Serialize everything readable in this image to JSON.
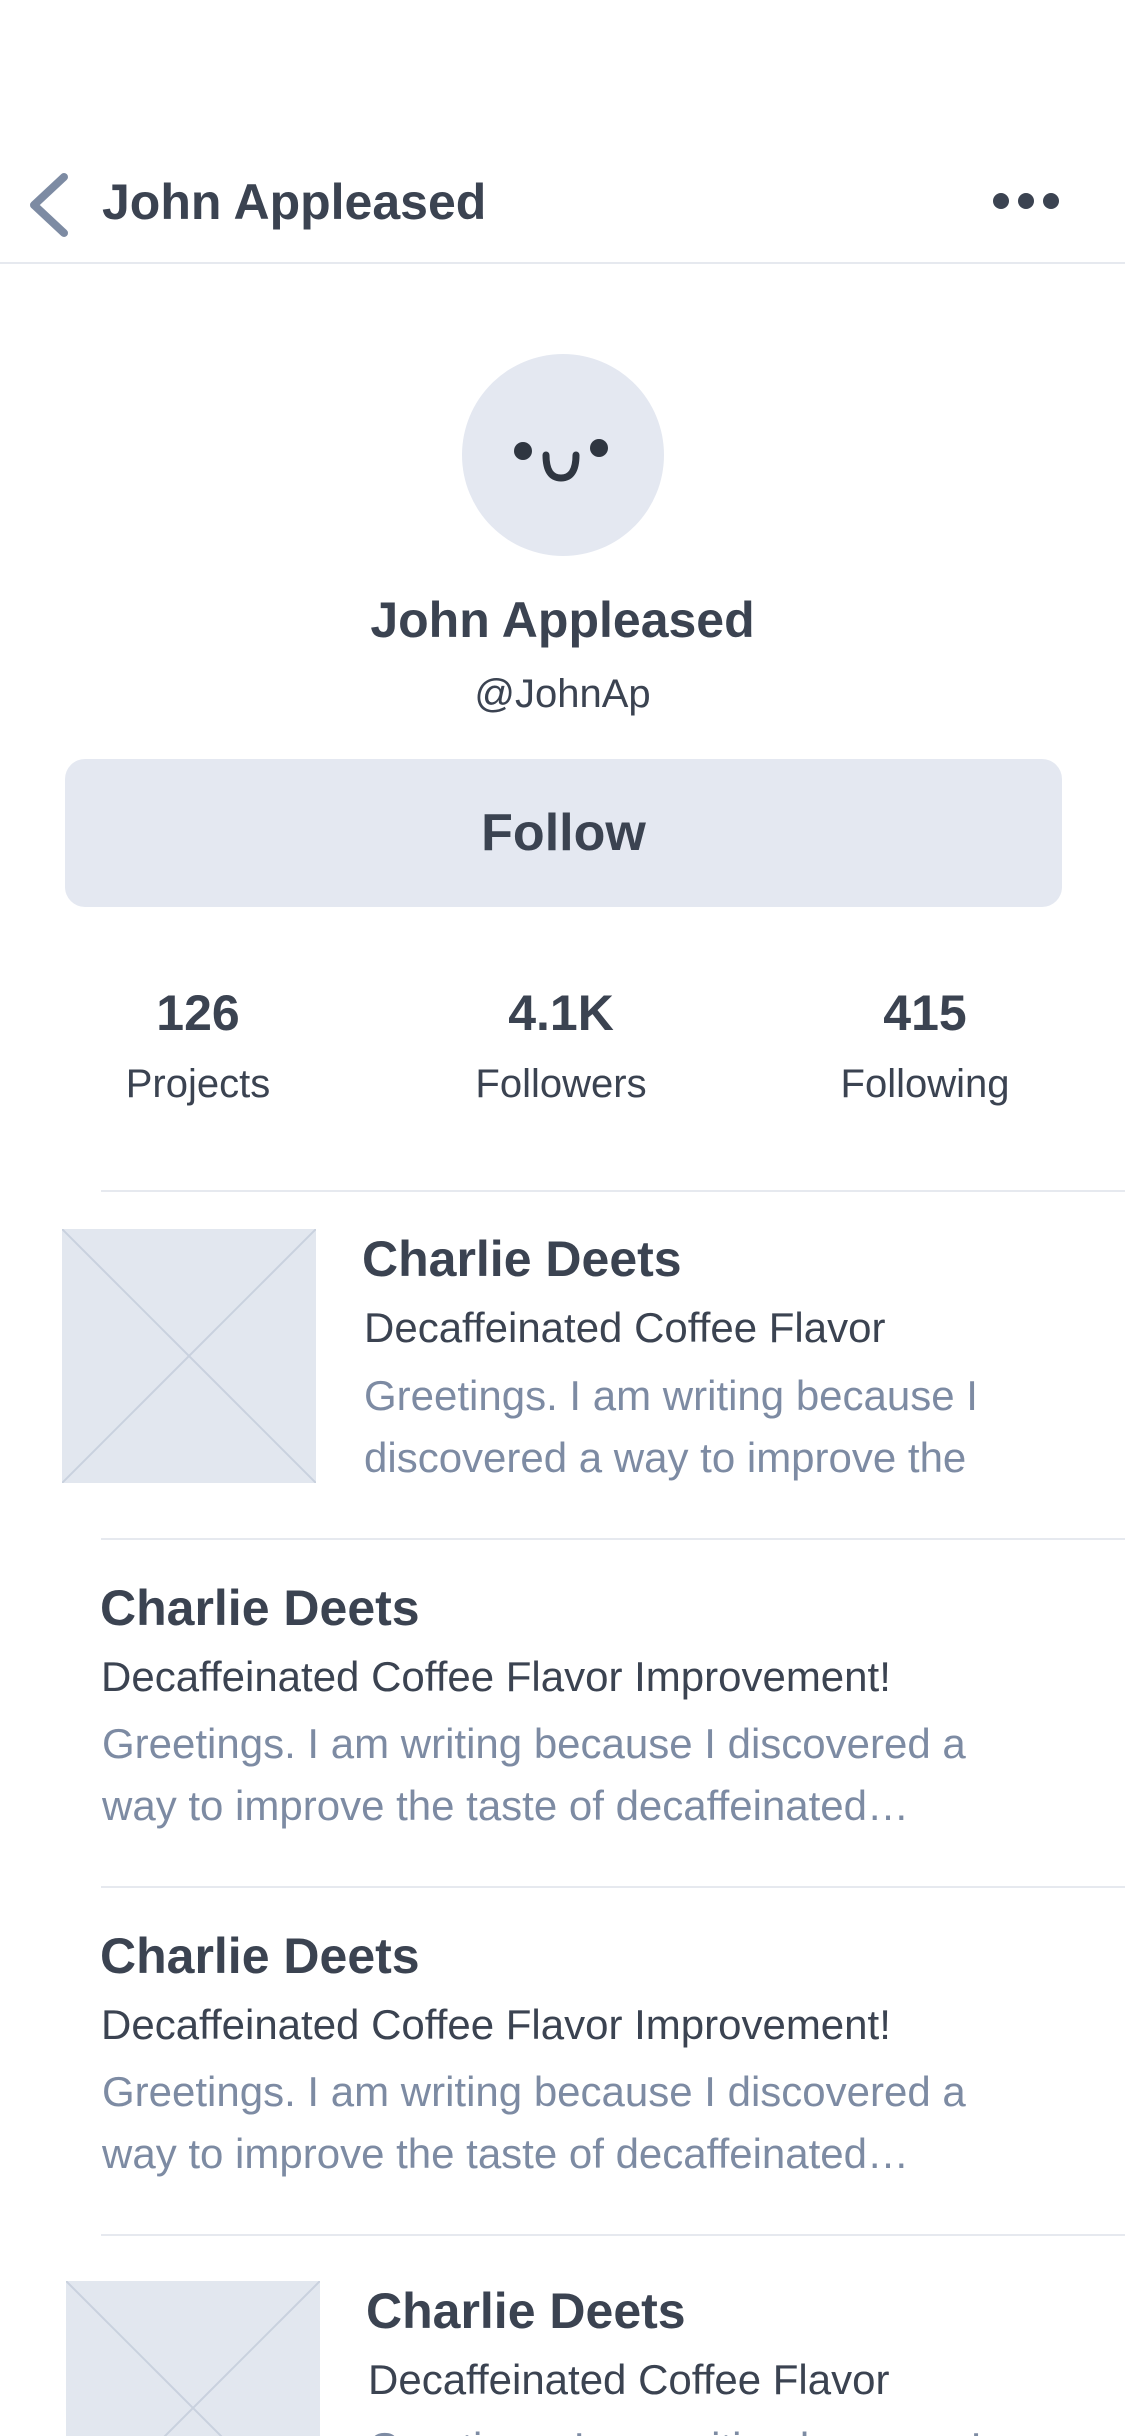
{
  "header": {
    "title": "John Appleased",
    "back_icon": "chevron-left-icon",
    "more_icon": "more-horizontal-icon"
  },
  "profile": {
    "name": "John Appleased",
    "handle": "@JohnAp",
    "follow_label": "Follow"
  },
  "stats": [
    {
      "value": "126",
      "label": "Projects"
    },
    {
      "value": "4.1K",
      "label": "Followers"
    },
    {
      "value": "415",
      "label": "Following"
    }
  ],
  "feed": [
    {
      "author": "Charlie Deets",
      "subject": "Decaffeinated Coffee Flavor",
      "preview_line1": "Greetings. I am writing because I",
      "preview_line2": "discovered a way to improve the"
    },
    {
      "author": "Charlie Deets",
      "subject": "Decaffeinated Coffee Flavor Improvement!",
      "preview_line1": "Greetings. I am writing because I discovered a",
      "preview_line2": "way to improve the taste of decaffeinated…"
    },
    {
      "author": "Charlie Deets",
      "subject": "Decaffeinated Coffee Flavor Improvement!",
      "preview_line1": "Greetings. I am writing because I discovered a",
      "preview_line2": "way to improve the taste of decaffeinated…"
    },
    {
      "author": "Charlie Deets",
      "subject": "Decaffeinated Coffee Flavor",
      "preview_line1": "Greetings. I am writing because I"
    }
  ],
  "colors": {
    "text": "#3b4351",
    "muted": "#7d8ba3",
    "surface": "#e4e8f1",
    "divider": "#e6e9ef"
  }
}
